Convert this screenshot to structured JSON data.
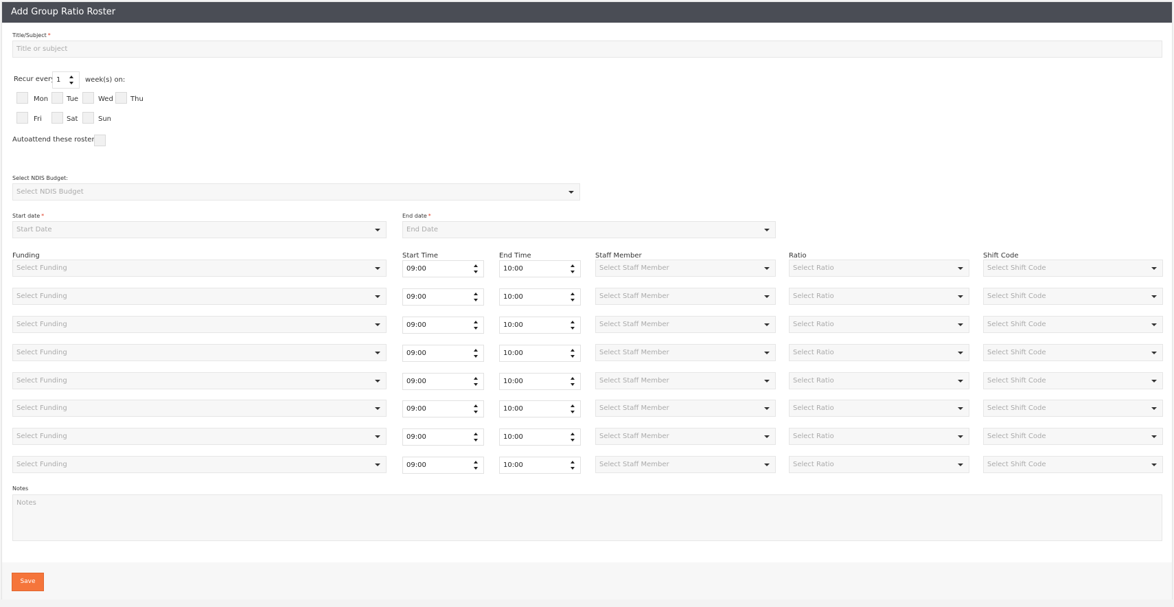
{
  "window": {
    "title": "Add Group Ratio Roster"
  },
  "title_field": {
    "label": "Title/Subject",
    "required_mark": "*",
    "placeholder": "Title or subject"
  },
  "recur": {
    "prefix": "Recur every",
    "value": "1",
    "suffix": "week(s) on:"
  },
  "days": [
    "Mon",
    "Tue",
    "Wed",
    "Thu",
    "Fri",
    "Sat",
    "Sun"
  ],
  "autoattend": {
    "label": "Autoattend these rosters?"
  },
  "ndis": {
    "label": "Select NDIS Budget:",
    "placeholder": "Select NDIS Budget"
  },
  "start_date": {
    "label": "Start date",
    "required_mark": "*",
    "placeholder": "Start Date"
  },
  "end_date": {
    "label": "End date",
    "required_mark": "*",
    "placeholder": "End Date"
  },
  "columns": {
    "funding": "Funding",
    "start_time": "Start Time",
    "end_time": "End Time",
    "staff": "Staff Member",
    "ratio": "Ratio",
    "shift": "Shift Code"
  },
  "rows": [
    {
      "funding": "Select Funding",
      "start": "09:00",
      "end": "10:00",
      "staff": "Select Staff Member",
      "ratio": "Select Ratio",
      "shift": "Select Shift Code"
    },
    {
      "funding": "Select Funding",
      "start": "09:00",
      "end": "10:00",
      "staff": "Select Staff Member",
      "ratio": "Select Ratio",
      "shift": "Select Shift Code"
    },
    {
      "funding": "Select Funding",
      "start": "09:00",
      "end": "10:00",
      "staff": "Select Staff Member",
      "ratio": "Select Ratio",
      "shift": "Select Shift Code"
    },
    {
      "funding": "Select Funding",
      "start": "09:00",
      "end": "10:00",
      "staff": "Select Staff Member",
      "ratio": "Select Ratio",
      "shift": "Select Shift Code"
    },
    {
      "funding": "Select Funding",
      "start": "09:00",
      "end": "10:00",
      "staff": "Select Staff Member",
      "ratio": "Select Ratio",
      "shift": "Select Shift Code"
    },
    {
      "funding": "Select Funding",
      "start": "09:00",
      "end": "10:00",
      "staff": "Select Staff Member",
      "ratio": "Select Ratio",
      "shift": "Select Shift Code"
    },
    {
      "funding": "Select Funding",
      "start": "09:00",
      "end": "10:00",
      "staff": "Select Staff Member",
      "ratio": "Select Ratio",
      "shift": "Select Shift Code"
    },
    {
      "funding": "Select Funding",
      "start": "09:00",
      "end": "10:00",
      "staff": "Select Staff Member",
      "ratio": "Select Ratio",
      "shift": "Select Shift Code"
    }
  ],
  "notes": {
    "label": "Notes",
    "placeholder": "Notes"
  },
  "footer": {
    "save_label": "Save"
  },
  "colors": {
    "header_bg": "#4a4d55",
    "save_button": "#f5753b",
    "required": "#e03b24"
  }
}
